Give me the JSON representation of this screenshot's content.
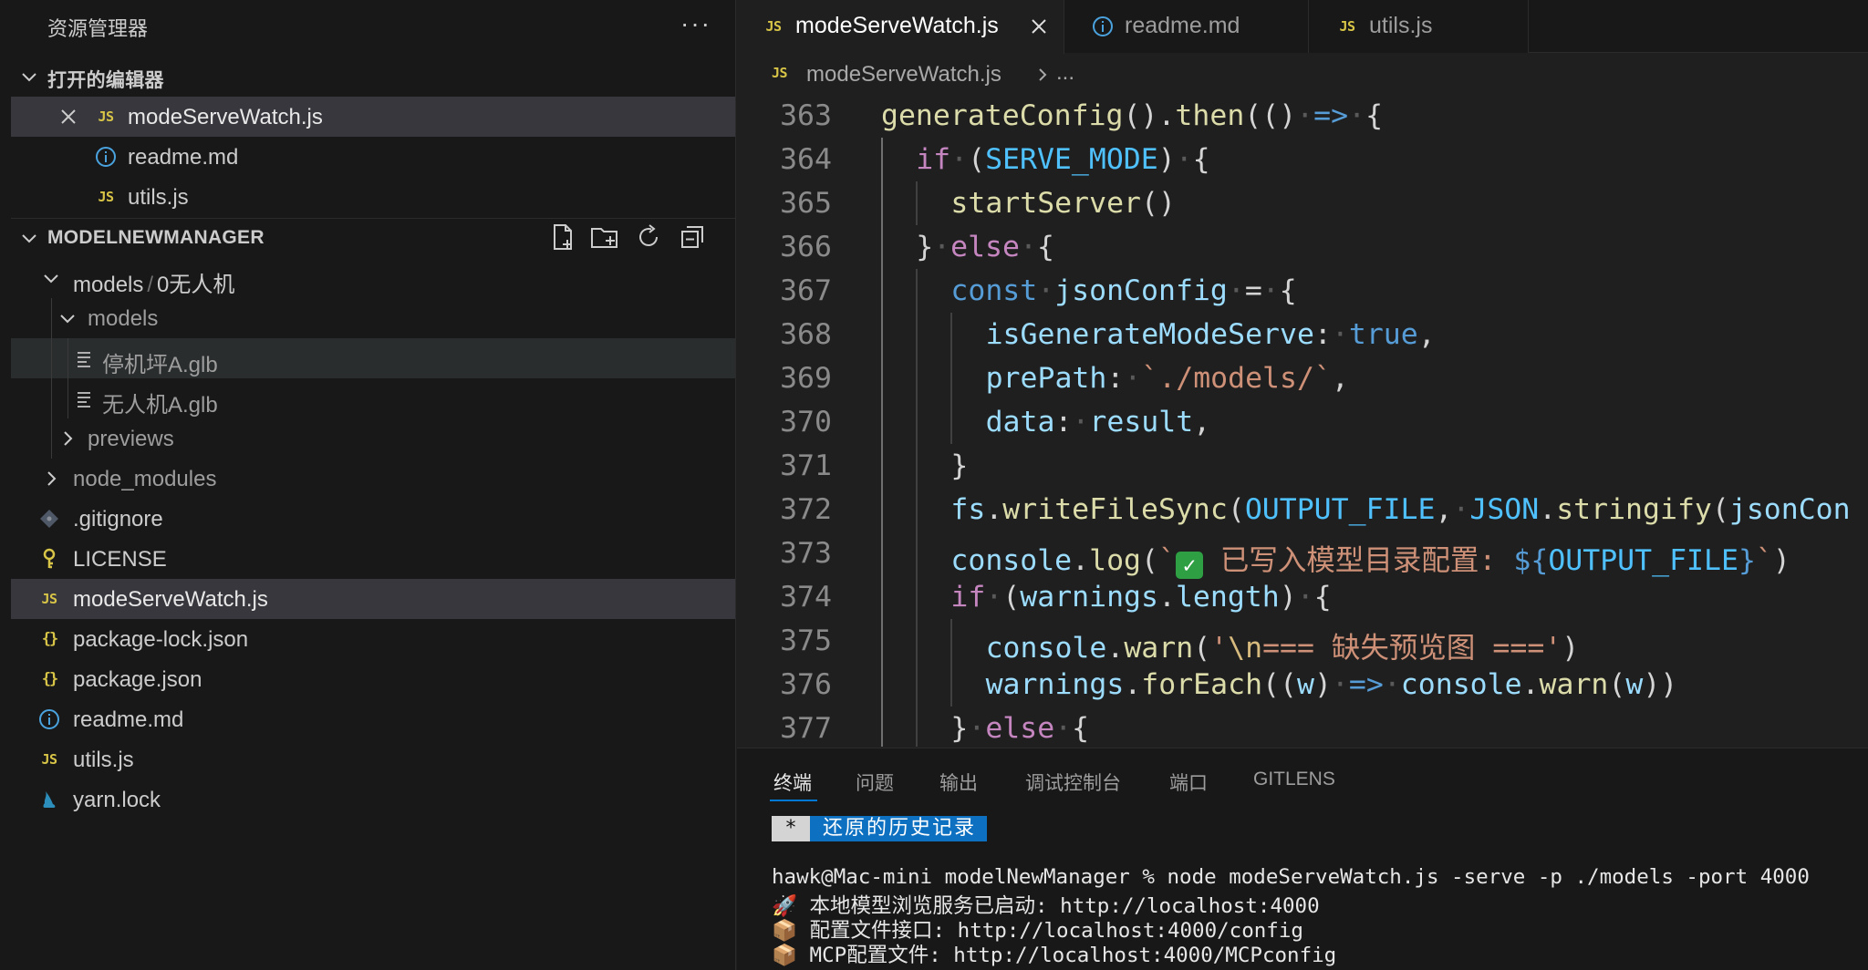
{
  "sidebar": {
    "title": "资源管理器",
    "more": "···",
    "open_editors": {
      "label": "打开的编辑器",
      "items": [
        {
          "badge": "JS",
          "name": "modeServeWatch.js"
        },
        {
          "badge": "i",
          "name": "readme.md"
        },
        {
          "badge": "JS",
          "name": "utils.js"
        }
      ]
    },
    "project": {
      "label": "MODELNEWMANAGER",
      "tree": {
        "folder_compact": "models",
        "folder_compact_sep": "/",
        "folder_compact_child": "0无人机",
        "models": "models",
        "file1": "停机坪A.glb",
        "file2": "无人机A.glb",
        "previews": "previews",
        "node_modules": "node_modules",
        "gitignore": ".gitignore",
        "license": "LICENSE",
        "mode_serve_watch": "modeServeWatch.js",
        "package_lock": "package-lock.json",
        "package": "package.json",
        "readme": "readme.md",
        "utils": "utils.js",
        "yarn_lock": "yarn.lock"
      },
      "badges": {
        "js": "JS",
        "json": "{}",
        "info": "i"
      }
    }
  },
  "tabs": [
    {
      "badge": "JS",
      "label": "modeServeWatch.js",
      "active": true
    },
    {
      "badge": "i",
      "label": "readme.md",
      "active": false
    },
    {
      "badge": "JS",
      "label": "utils.js",
      "active": false
    }
  ],
  "breadcrumb": {
    "badge": "JS",
    "file": "modeServeWatch.js",
    "more": "..."
  },
  "code": {
    "lines": [
      {
        "n": "363",
        "t": [
          [
            "fn",
            "generateConfig"
          ],
          [
            "punc",
            "()."
          ],
          [
            "fn",
            "then"
          ],
          [
            "punc",
            "(()"
          ],
          [
            "dot",
            "·"
          ],
          [
            "kw2",
            "=>"
          ],
          [
            "dot",
            "·"
          ],
          [
            "punc",
            "{"
          ]
        ]
      },
      {
        "n": "364",
        "t": [
          [
            "kw",
            "if"
          ],
          [
            "dot",
            "·"
          ],
          [
            "punc",
            "("
          ],
          [
            "const",
            "SERVE_MODE"
          ],
          [
            "punc",
            ")"
          ],
          [
            "dot",
            "·"
          ],
          [
            "punc",
            "{"
          ]
        ]
      },
      {
        "n": "365",
        "t": [
          [
            "fn",
            "startServer"
          ],
          [
            "punc",
            "()"
          ]
        ]
      },
      {
        "n": "366",
        "t": [
          [
            "punc",
            "}"
          ],
          [
            "dot",
            "·"
          ],
          [
            "kw",
            "else"
          ],
          [
            "dot",
            "·"
          ],
          [
            "punc",
            "{"
          ]
        ]
      },
      {
        "n": "367",
        "t": [
          [
            "kw2",
            "const"
          ],
          [
            "dot",
            "·"
          ],
          [
            "var",
            "jsonConfig"
          ],
          [
            "dot",
            "·"
          ],
          [
            "punc",
            "="
          ],
          [
            "dot",
            "·"
          ],
          [
            "punc",
            "{"
          ]
        ]
      },
      {
        "n": "368",
        "t": [
          [
            "var",
            "isGenerateModeServe"
          ],
          [
            "punc",
            ":"
          ],
          [
            "dot",
            "·"
          ],
          [
            "bool",
            "true"
          ],
          [
            "punc",
            ","
          ]
        ]
      },
      {
        "n": "369",
        "t": [
          [
            "var",
            "prePath"
          ],
          [
            "punc",
            ":"
          ],
          [
            "dot",
            "·"
          ],
          [
            "str",
            "`./models/`"
          ],
          [
            "punc",
            ","
          ]
        ]
      },
      {
        "n": "370",
        "t": [
          [
            "var",
            "data"
          ],
          [
            "punc",
            ":"
          ],
          [
            "dot",
            "·"
          ],
          [
            "var",
            "result"
          ],
          [
            "punc",
            ","
          ]
        ]
      },
      {
        "n": "371",
        "t": [
          [
            "punc",
            "}"
          ]
        ]
      },
      {
        "n": "372",
        "t": [
          [
            "var",
            "fs"
          ],
          [
            "punc",
            "."
          ],
          [
            "fn",
            "writeFileSync"
          ],
          [
            "punc",
            "("
          ],
          [
            "const",
            "OUTPUT_FILE"
          ],
          [
            "punc",
            ","
          ],
          [
            "dot",
            "·"
          ],
          [
            "const",
            "JSON"
          ],
          [
            "punc",
            "."
          ],
          [
            "fn",
            "stringify"
          ],
          [
            "punc",
            "("
          ],
          [
            "var",
            "jsonCon"
          ]
        ]
      },
      {
        "n": "373",
        "t": [
          [
            "var",
            "console"
          ],
          [
            "punc",
            "."
          ],
          [
            "fn",
            "log"
          ],
          [
            "punc",
            "("
          ],
          [
            "str",
            "`"
          ],
          [
            "check",
            "✓"
          ],
          [
            "str",
            " 已写入模型目录配置: "
          ],
          [
            "kw2",
            "${"
          ],
          [
            "const",
            "OUTPUT_FILE"
          ],
          [
            "kw2",
            "}"
          ],
          [
            "str",
            "`"
          ],
          [
            "punc",
            ")"
          ]
        ]
      },
      {
        "n": "374",
        "t": [
          [
            "kw",
            "if"
          ],
          [
            "dot",
            "·"
          ],
          [
            "punc",
            "("
          ],
          [
            "var",
            "warnings"
          ],
          [
            "punc",
            "."
          ],
          [
            "var",
            "length"
          ],
          [
            "punc",
            ")"
          ],
          [
            "dot",
            "·"
          ],
          [
            "punc",
            "{"
          ]
        ]
      },
      {
        "n": "375",
        "t": [
          [
            "var",
            "console"
          ],
          [
            "punc",
            "."
          ],
          [
            "fn",
            "warn"
          ],
          [
            "punc",
            "("
          ],
          [
            "str",
            "'"
          ],
          [
            "esc",
            "\\n"
          ],
          [
            "str",
            "=== 缺失预览图 ==='"
          ],
          [
            "punc",
            ")"
          ]
        ]
      },
      {
        "n": "376",
        "t": [
          [
            "var",
            "warnings"
          ],
          [
            "punc",
            "."
          ],
          [
            "fn",
            "forEach"
          ],
          [
            "punc",
            "(("
          ],
          [
            "var",
            "w"
          ],
          [
            "punc",
            ")"
          ],
          [
            "dot",
            "·"
          ],
          [
            "kw2",
            "=>"
          ],
          [
            "dot",
            "·"
          ],
          [
            "var",
            "console"
          ],
          [
            "punc",
            "."
          ],
          [
            "fn",
            "warn"
          ],
          [
            "punc",
            "("
          ],
          [
            "var",
            "w"
          ],
          [
            "punc",
            "))"
          ]
        ]
      },
      {
        "n": "377",
        "t": [
          [
            "punc",
            "}"
          ],
          [
            "dot",
            "·"
          ],
          [
            "kw",
            "else"
          ],
          [
            "dot",
            "·"
          ],
          [
            "punc",
            "{"
          ]
        ]
      }
    ]
  },
  "panel": {
    "tabs": [
      "终端",
      "问题",
      "输出",
      "调试控制台",
      "端口",
      "GITLENS"
    ],
    "restore_star": "*",
    "restore_msg": "还原的历史记录",
    "terminal": [
      "hawk@Mac-mini modelNewManager % node modeServeWatch.js -serve -p ./models -port 4000",
      "🚀 本地模型浏览服务已启动: http://localhost:4000",
      "📦 配置文件接口: http://localhost:4000/config",
      "📦 MCP配置文件: http://localhost:4000/MCPconfig"
    ]
  }
}
